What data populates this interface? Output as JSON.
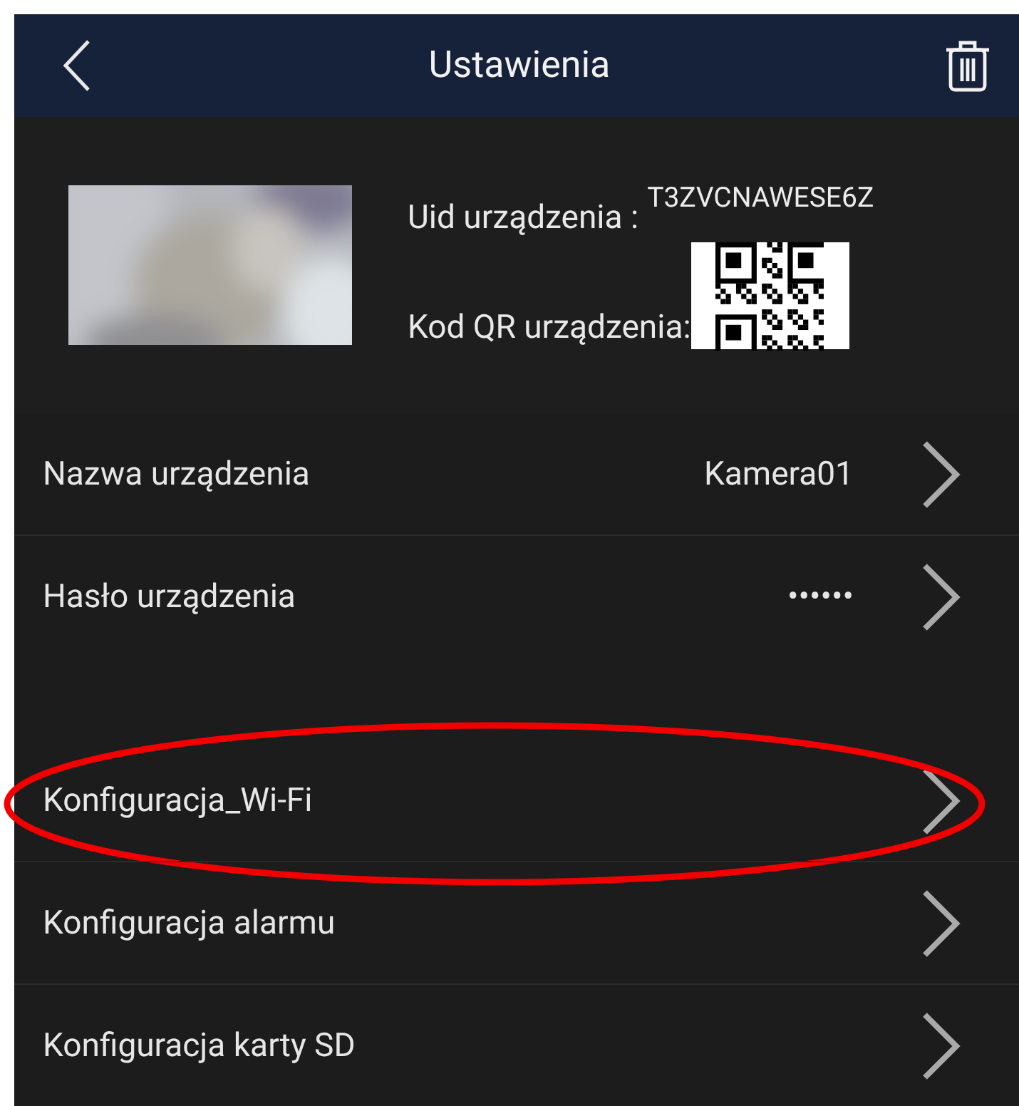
{
  "header": {
    "title": "Ustawienia"
  },
  "device": {
    "uid_label": "Uid urządzenia :",
    "uid": "T3ZVCNAWESE6Z",
    "qr_label": "Kod QR urządzenia:"
  },
  "groups": [
    {
      "items": [
        {
          "label": "Nazwa urządzenia",
          "value": "Kamera01",
          "circled": false
        },
        {
          "label": "Hasło urządzenia",
          "value": "••••••",
          "circled": false
        }
      ]
    },
    {
      "items": [
        {
          "label": "Konfiguracja_Wi-Fi",
          "circled": true
        },
        {
          "label": "Konfiguracja alarmu",
          "circled": false
        },
        {
          "label": "Konfiguracja karty SD",
          "circled": false
        }
      ]
    }
  ]
}
